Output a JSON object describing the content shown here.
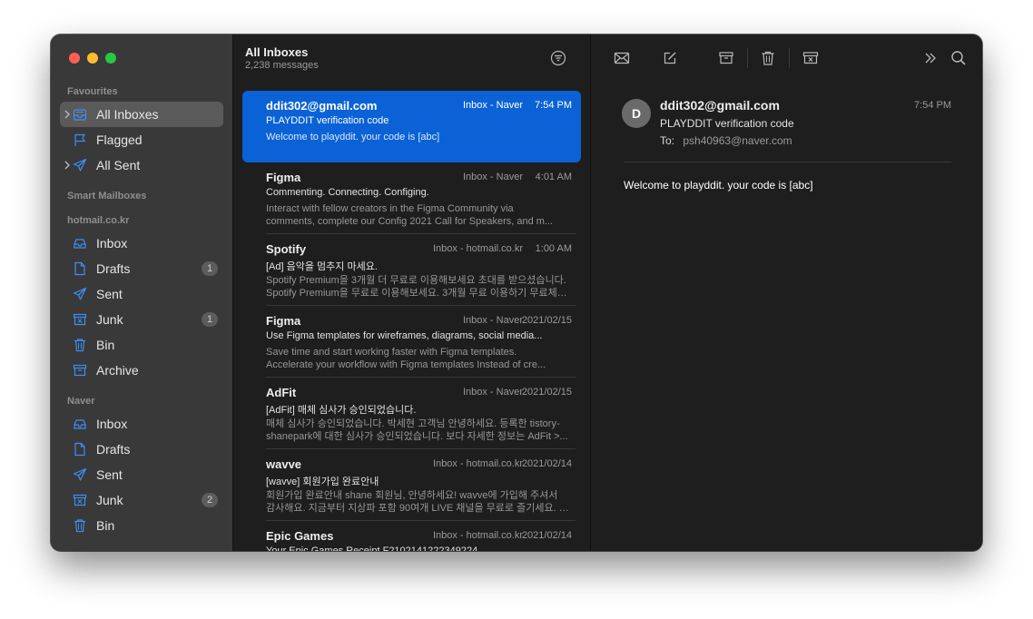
{
  "sidebar": {
    "sections": [
      {
        "title": "Favourites",
        "items": [
          {
            "label": "All Inboxes",
            "icon": "inbox-stack-icon",
            "selected": true,
            "expandable": true
          },
          {
            "label": "Flagged",
            "icon": "flag-icon"
          },
          {
            "label": "All Sent",
            "icon": "paper-plane-icon",
            "expandable": true
          }
        ]
      },
      {
        "title": "Smart Mailboxes",
        "items": []
      },
      {
        "title": "hotmail.co.kr",
        "items": [
          {
            "label": "Inbox",
            "icon": "inbox-icon"
          },
          {
            "label": "Drafts",
            "icon": "document-icon",
            "badge": "1"
          },
          {
            "label": "Sent",
            "icon": "paper-plane-icon"
          },
          {
            "label": "Junk",
            "icon": "junk-icon",
            "badge": "1"
          },
          {
            "label": "Bin",
            "icon": "trash-icon"
          },
          {
            "label": "Archive",
            "icon": "archive-icon"
          }
        ]
      },
      {
        "title": "Naver",
        "items": [
          {
            "label": "Inbox",
            "icon": "inbox-icon"
          },
          {
            "label": "Drafts",
            "icon": "document-icon"
          },
          {
            "label": "Sent",
            "icon": "paper-plane-icon"
          },
          {
            "label": "Junk",
            "icon": "junk-icon",
            "badge": "2"
          },
          {
            "label": "Bin",
            "icon": "trash-icon"
          }
        ]
      }
    ]
  },
  "list": {
    "title": "All Inboxes",
    "count": "2,238 messages",
    "messages": [
      {
        "from": "ddit302@gmail.com",
        "mailbox": "Inbox - Naver",
        "time": "7:54 PM",
        "subject": "PLAYDDIT verification code",
        "preview": [
          "Welcome to playddit. your code is [abc]",
          ""
        ],
        "selected": true
      },
      {
        "from": "Figma",
        "mailbox": "Inbox - Naver",
        "time": "4:01 AM",
        "subject": "Commenting. Connecting. Configing.",
        "preview": [
          "Interact with fellow creators in the Figma Community via",
          "comments, complete our Config 2021 Call for Speakers, and m..."
        ]
      },
      {
        "from": "Spotify",
        "mailbox": "Inbox - hotmail.co.kr",
        "time": "1:00 AM",
        "subject": "[Ad] 음악을 멈추지 마세요.",
        "preview": [
          "Spotify Premium을 3개월 더 무료로 이용해보세요 초대를 받으셨습니다.",
          "Spotify Premium을 무료로 이용해보세요. 3개월 무료 이용하기 무료체험..."
        ]
      },
      {
        "from": "Figma",
        "mailbox": "Inbox - Naver",
        "time": "2021/02/15",
        "subject": "Use Figma templates for wireframes, diagrams, social media...",
        "preview": [
          "Save time and start working faster with Figma templates.",
          "Accelerate your workflow with Figma templates Instead of cre..."
        ]
      },
      {
        "from": "AdFit",
        "mailbox": "Inbox - Naver",
        "time": "2021/02/15",
        "subject": "[AdFit] 매체 심사가 승인되었습니다.",
        "preview": [
          "매체 심사가 승인되었습니다. 박세현 고객님 안녕하세요. 등록한 tistory-",
          "shanepark에 대한 심사가 승인되었습니다. 보다 자세한 정보는 AdFit >..."
        ]
      },
      {
        "from": "wavve",
        "mailbox": "Inbox - hotmail.co.kr",
        "time": "2021/02/14",
        "subject": "[wavve] 회원가입 완료안내",
        "preview": [
          "회원가입 완료안내 shane 회원님, 안녕하세요! wavve에 가입해 주셔서",
          "감사해요. 지금부터 지상파 포함 90여개 LIVE 채널을 무료로 즐기세요. SN..."
        ]
      },
      {
        "from": "Epic Games",
        "mailbox": "Inbox - hotmail.co.kr",
        "time": "2021/02/14",
        "subject": "Your Epic Games Receipt F2102141222349224",
        "preview": [
          "",
          ""
        ]
      }
    ]
  },
  "reader": {
    "avatar": "D",
    "from": "ddit302@gmail.com",
    "time": "7:54 PM",
    "subject": "PLAYDDIT verification code",
    "to_label": "To:",
    "to": "psh40963@naver.com",
    "body": "Welcome to playddit. your code is [abc]"
  },
  "toolbar": {
    "icons": [
      "envelope-icon",
      "compose-icon",
      "archive-icon",
      "trash-icon",
      "junk-icon",
      "more-chevrons-icon",
      "search-icon"
    ]
  },
  "colors": {
    "accent": "#0b62d6",
    "sidebar_icon": "#3d8ef7",
    "traffic_red": "#ff5f57",
    "traffic_yellow": "#febc2e",
    "traffic_green": "#28c840"
  }
}
